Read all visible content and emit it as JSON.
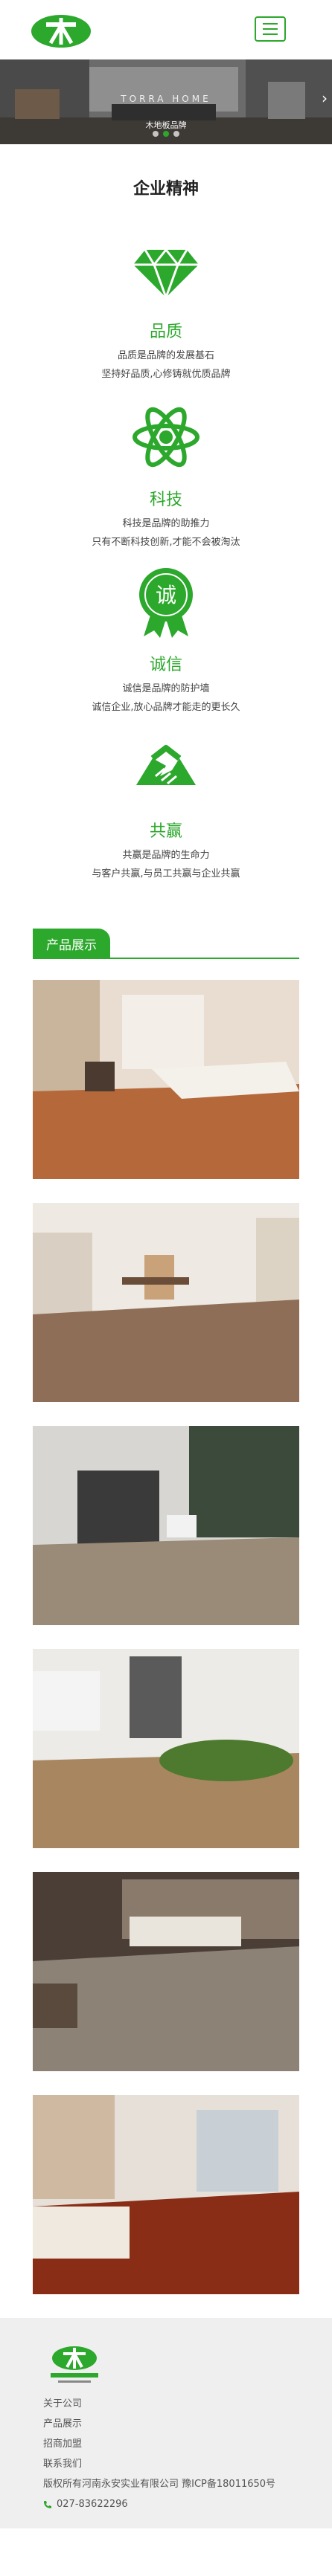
{
  "header": {
    "menu_icon": "menu-icon"
  },
  "banner": {
    "caption": "TORRA HOME",
    "sub": "木地板品牌"
  },
  "spirit": {
    "title": "企业精神",
    "items": [
      {
        "icon": "diamond-icon",
        "title": "品质",
        "line1": "品质是品牌的发展基石",
        "line2": "坚持好品质,心修铸就优质品牌"
      },
      {
        "icon": "atom-icon",
        "title": "科技",
        "line1": "科技是品牌的助推力",
        "line2": "只有不断科技创新,才能不会被淘汰"
      },
      {
        "icon": "medal-icon",
        "title": "诚信",
        "badge": "诚",
        "line1": "诚信是品牌的防护墙",
        "line2": "诚信企业,放心品牌才能走的更长久"
      },
      {
        "icon": "handshake-icon",
        "title": "共赢",
        "line1": "共赢是品牌的生命力",
        "line2": "与客户共赢,与员工共赢与企业共赢"
      }
    ]
  },
  "products": {
    "title": "产品展示",
    "count": 6
  },
  "footer": {
    "links": [
      "关于公司",
      "产品展示",
      "招商加盟",
      "联系我们"
    ],
    "copyright": "版权所有河南永安实业有限公司 豫ICP备18011650号",
    "phone": "027-83622296"
  },
  "colors": {
    "brand": "#2ca82c",
    "footer_bg": "#efefef"
  }
}
